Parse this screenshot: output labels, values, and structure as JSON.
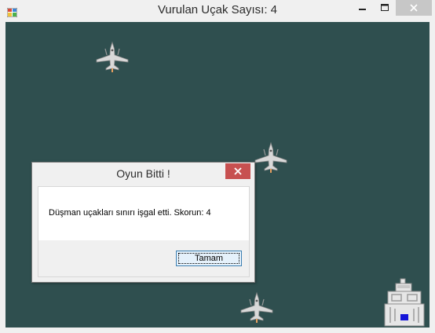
{
  "window": {
    "title": "Vurulan Uçak Sayısı: 4",
    "icon": "app-icon",
    "controls": [
      "minimize-icon",
      "maximize-icon",
      "close-icon"
    ]
  },
  "game": {
    "background_color": "#2f4f4f",
    "sprites": [
      "enemy-plane",
      "enemy-plane",
      "enemy-plane",
      "player-ship"
    ]
  },
  "dialog": {
    "title": "Oyun Bitti !",
    "message": "Düşman uçakları sınırı işgal etti. Skorun: 4",
    "ok_label": "Tamam"
  }
}
